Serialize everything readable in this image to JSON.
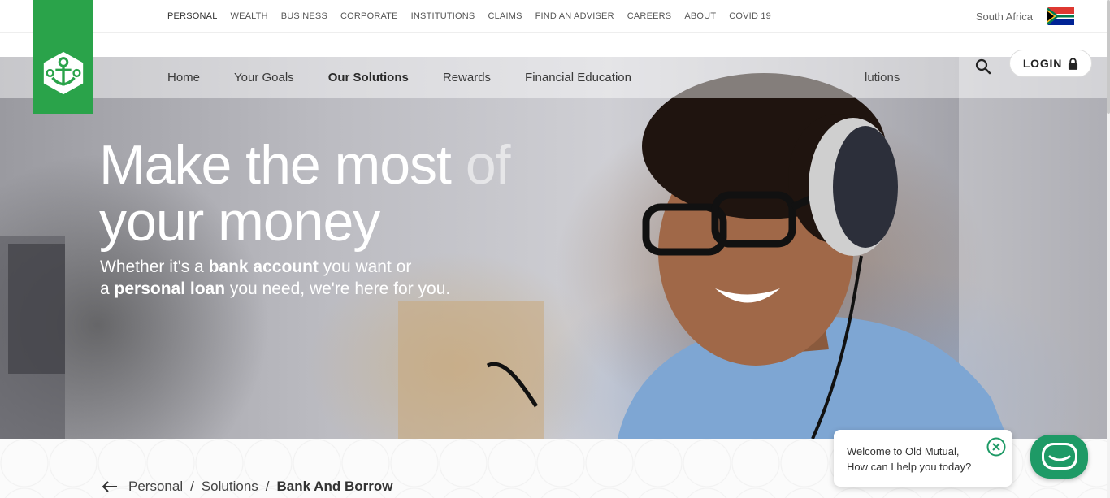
{
  "topnav": {
    "items": [
      "PERSONAL",
      "WEALTH",
      "BUSINESS",
      "CORPORATE",
      "INSTITUTIONS",
      "CLAIMS",
      "FIND AN ADVISER",
      "CAREERS",
      "ABOUT",
      "COVID 19"
    ],
    "region": "South Africa"
  },
  "mainnav": {
    "items": [
      "Home",
      "Your Goals",
      "Our Solutions",
      "Rewards",
      "Financial Education"
    ],
    "extra": "lutions",
    "login": "LOGIN"
  },
  "hero": {
    "title_line1_bright": "Make the most",
    "title_line1_faded": " of",
    "title_line2": "your money",
    "sub_pre": "Whether it's a ",
    "sub_bold1": "bank account",
    "sub_mid": " you want or",
    "sub_pre2": "a ",
    "sub_bold2": "personal loan",
    "sub_post": " you need, we're here for you."
  },
  "breadcrumb": {
    "items": [
      "Personal",
      "Solutions",
      "Bank And Borrow"
    ]
  },
  "chat": {
    "line1": "Welcome to Old Mutual,",
    "line2": "How can I help you today?"
  },
  "colors": {
    "brand_green": "#2aa34a",
    "chat_green": "#1e9a66"
  }
}
